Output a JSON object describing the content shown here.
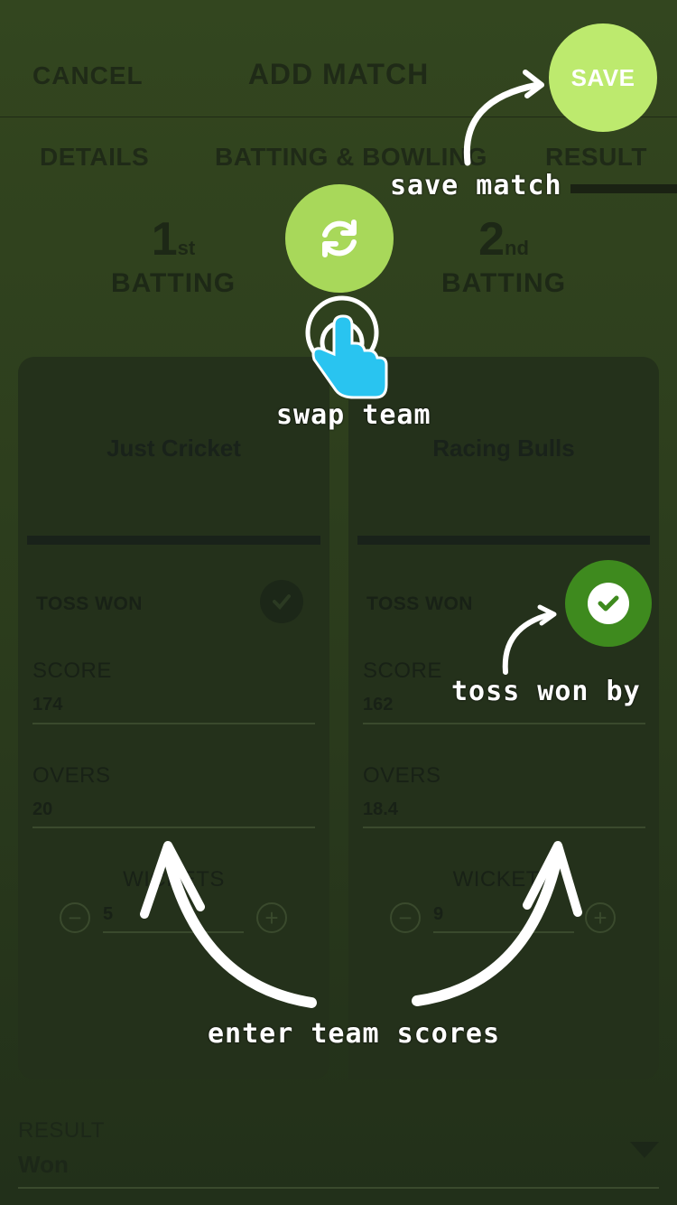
{
  "header": {
    "cancel_label": "CANCEL",
    "title": "ADD MATCH",
    "save_label": "SAVE"
  },
  "tabs": [
    {
      "label": "DETAILS"
    },
    {
      "label": "BATTING & BOWLING"
    },
    {
      "label": "RESULT"
    }
  ],
  "batting": {
    "first": {
      "num": "1",
      "sup": "st",
      "word": "BATTING"
    },
    "second": {
      "num": "2",
      "sup": "nd",
      "word": "BATTING"
    }
  },
  "teams": [
    {
      "name": "Just Cricket",
      "toss_label": "TOSS WON",
      "score_label": "SCORE",
      "score": "174",
      "overs_label": "OVERS",
      "overs": "20",
      "wickets_label": "WICKETS",
      "wickets": "5"
    },
    {
      "name": "Racing Bulls",
      "toss_label": "TOSS WON",
      "score_label": "SCORE",
      "score": "162",
      "overs_label": "OVERS",
      "overs": "18.4",
      "wickets_label": "WICKETS",
      "wickets": "9"
    }
  ],
  "result": {
    "label": "RESULT",
    "value": "Won"
  },
  "coach": {
    "save": "save match",
    "swap": "swap team",
    "toss": "toss won by",
    "scores": "enter team scores"
  },
  "colors": {
    "accent": "#a8d85a",
    "toss_won": "#3e8a1e",
    "pointer": "#29c4f0"
  },
  "icons": {
    "swap": "refresh-icon",
    "toss": "check-icon",
    "hand": "pointer-hand-icon",
    "dropdown": "dropdown-icon"
  }
}
